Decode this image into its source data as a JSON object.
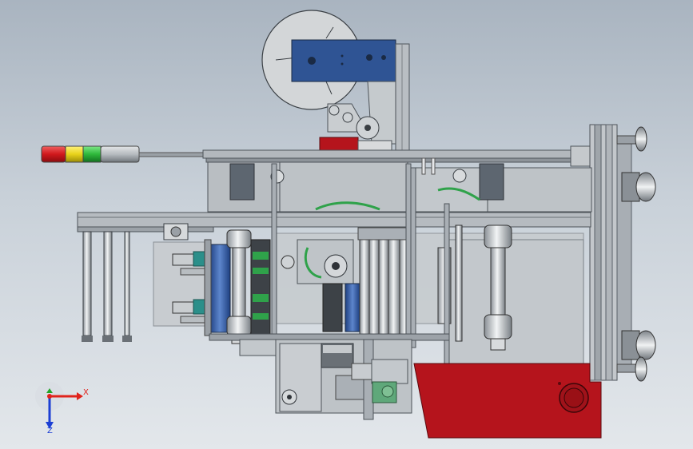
{
  "viewport": {
    "background_top": "#a9b4c0",
    "background_bottom": "#e3e7eb"
  },
  "triad": {
    "x_label": "X",
    "z_label": "Z",
    "x_color": "#e0231c",
    "y_color": "#22a52a",
    "z_color": "#1c3fd4"
  },
  "model_colors": {
    "frame_steel": "#a8aeb4",
    "frame_dark": "#5a6068",
    "panel_glass": "#c7cccf",
    "reel_plate_blue": "#2f5494",
    "guard_red": "#b5141c",
    "hose_green": "#2fa24a",
    "bracket_green": "#5fa87a",
    "signal_red": "#d0181c",
    "signal_yellow": "#e8d21a",
    "signal_green": "#2eb83a"
  },
  "signal_tower": [
    "red",
    "yellow",
    "green"
  ]
}
